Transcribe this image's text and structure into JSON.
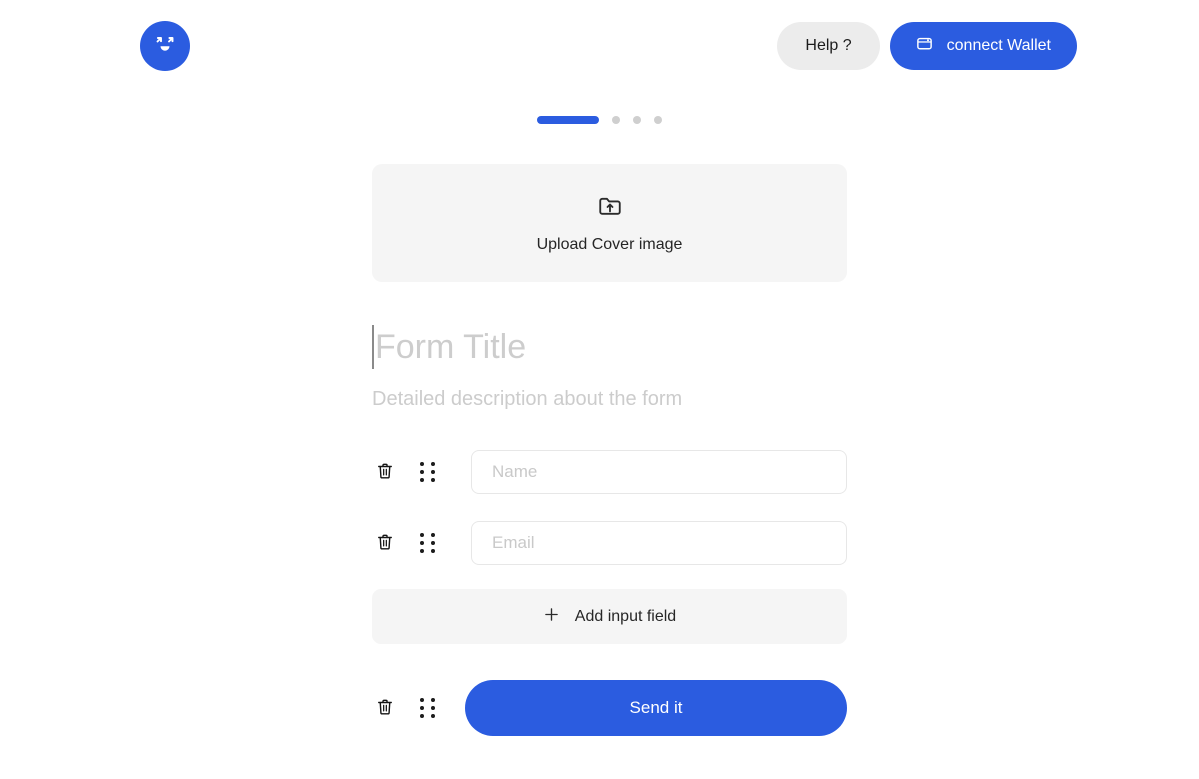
{
  "header": {
    "logo_icon": "smiley-arrows-logo",
    "help_label": "Help ?",
    "wallet_label": "connect Wallet",
    "wallet_icon": "wallet-icon"
  },
  "steps": {
    "total": 4,
    "active_index": 1,
    "items": [
      {
        "state": "active"
      },
      {
        "state": "inactive"
      },
      {
        "state": "inactive"
      },
      {
        "state": "inactive"
      }
    ]
  },
  "upload": {
    "icon": "folder-upload-icon",
    "label": "Upload Cover image"
  },
  "form": {
    "title_value": "",
    "title_placeholder": "Form Title",
    "description_value": "",
    "description_placeholder": "Detailed description about the form",
    "fields": [
      {
        "value": "",
        "placeholder": "Name",
        "delete_icon": "trash-icon",
        "drag_icon": "drag-handle-icon"
      },
      {
        "value": "",
        "placeholder": "Email",
        "delete_icon": "trash-icon",
        "drag_icon": "drag-handle-icon"
      }
    ],
    "add_field_label": "Add input field",
    "add_field_icon": "plus-icon",
    "submit": {
      "label": "Send it",
      "delete_icon": "trash-icon",
      "drag_icon": "drag-handle-icon"
    }
  },
  "colors": {
    "accent": "#2b5ce0",
    "surface": "#f5f5f5",
    "help_bg": "#ececec",
    "placeholder": "#c9c9c9",
    "border": "#e7e7e7",
    "dot_inactive": "#cfcfcf"
  }
}
